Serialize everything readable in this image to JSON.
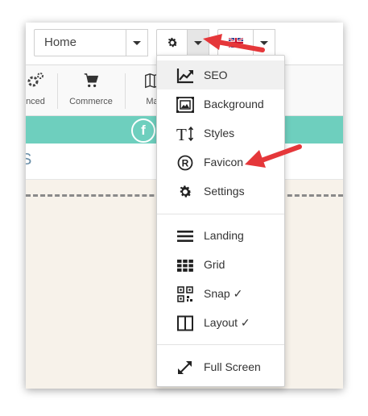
{
  "toolbar": {
    "page_select_value": "Home",
    "flag_label": "EN"
  },
  "toolbar2": {
    "advanced_label": "nced",
    "commerce_label": "Commerce",
    "maps_label": "Ma"
  },
  "strip": {
    "partial_text": "S"
  },
  "menu": {
    "items": [
      {
        "label": "SEO",
        "icon": "trend-chart-icon"
      },
      {
        "label": "Background",
        "icon": "background-image-icon"
      },
      {
        "label": "Styles",
        "icon": "text-size-icon"
      },
      {
        "label": "Favicon",
        "icon": "registered-mark-icon"
      },
      {
        "label": "Settings",
        "icon": "gear-icon"
      },
      {
        "label": "Landing",
        "icon": "hamburger-icon"
      },
      {
        "label": "Grid",
        "icon": "grid-icon"
      },
      {
        "label": "Snap ✓",
        "icon": "qr-code-icon"
      },
      {
        "label": "Layout ✓",
        "icon": "layout-icon"
      },
      {
        "label": "Full Screen",
        "icon": "expand-icon"
      }
    ]
  },
  "colors": {
    "accent_teal": "#6ecfbe",
    "annotation_arrow": "#e5373a"
  }
}
